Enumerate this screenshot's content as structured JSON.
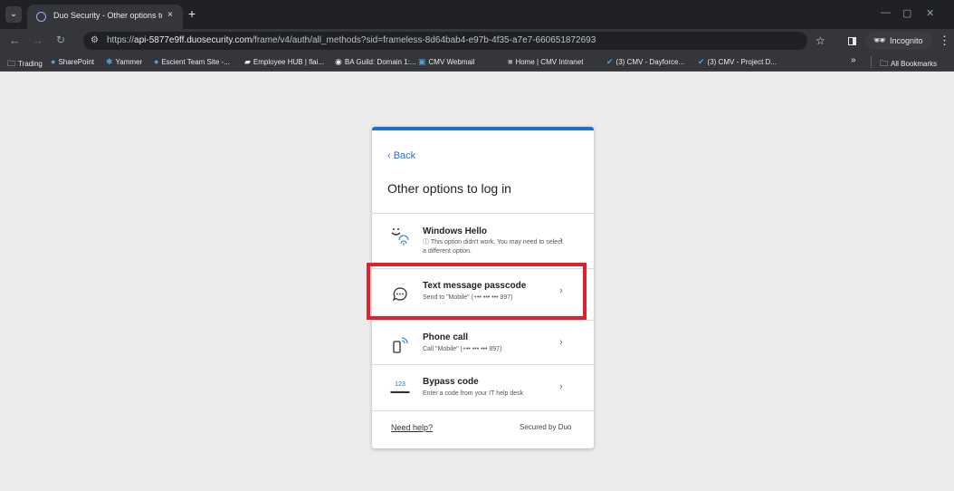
{
  "browser": {
    "tab_title": "Duo Security - Other options to",
    "tab_close": "×",
    "new_tab": "+",
    "url_prefix": "https://",
    "url_host": "api-5877e9ff.duosecurity.com",
    "url_path": "/frame/v4/auth/all_methods?sid=frameless-8d64bab4-e97b-4f35-a7e7-660651872693",
    "incognito_label": "Incognito",
    "bookmarks": [
      "Trading",
      "SharePoint",
      "Yammer",
      "Escient Team Site -...",
      "Employee HUB | flai...",
      "BA Guild: Domain 1:...",
      "CMV Webmail",
      "Home | CMV Intranet",
      "(3) CMV - Dayforce...",
      "(3) CMV - Project D..."
    ],
    "bookmarks_overflow": "»",
    "all_bookmarks": "All Bookmarks"
  },
  "card": {
    "back": "‹ Back",
    "title": "Other options to log in",
    "options": [
      {
        "title": "Windows Hello",
        "subtitle": "ⓘ This option didn't work. You may need to select a different option.",
        "icon": "windows-hello-icon"
      },
      {
        "title": "Text message passcode",
        "subtitle": "Send to \"Mobile\" (+•• ••• ••• 897)",
        "icon": "chat-bubble-icon"
      },
      {
        "title": "Phone call",
        "subtitle": "Call \"Mobile\" (+•• ••• ••• 897)",
        "icon": "phone-icon"
      },
      {
        "title": "Bypass code",
        "subtitle": "Enter a code from your IT help desk",
        "icon": "bypass-code-icon"
      }
    ],
    "bypass_glyph": "123",
    "need_help": "Need help?",
    "secured_by": "Secured by Duo"
  },
  "colors": {
    "duo_blue": "#1f6fd1",
    "highlight_red": "#e0202b",
    "chrome_dark": "#202124"
  }
}
